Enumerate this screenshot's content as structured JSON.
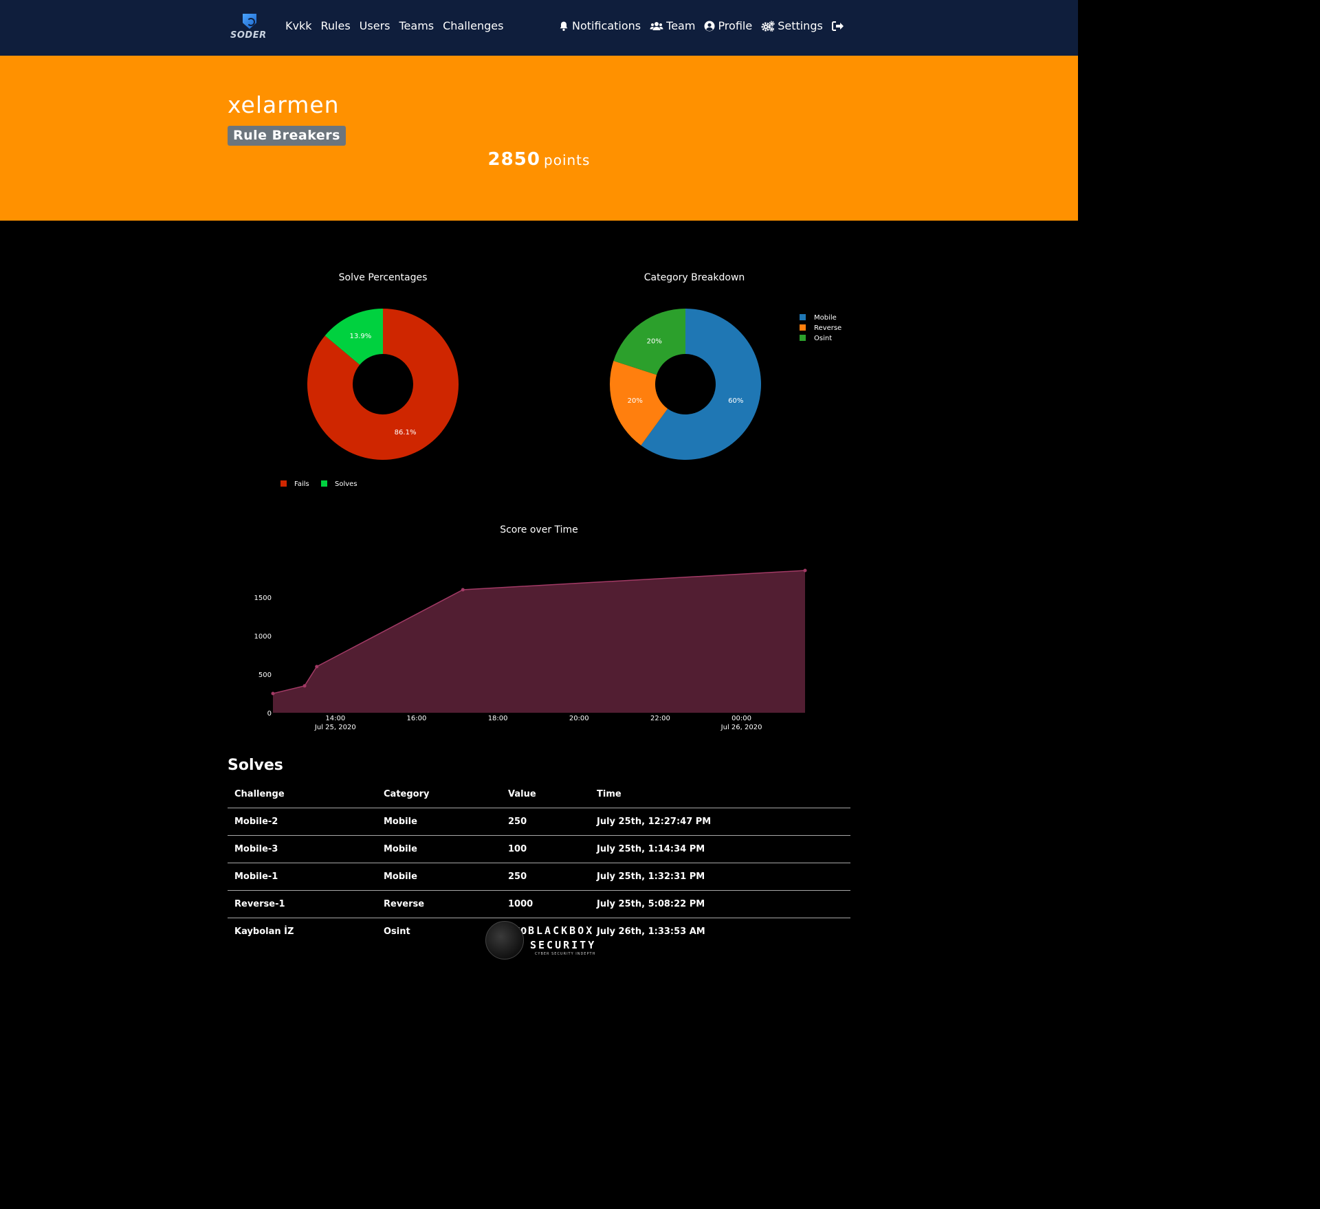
{
  "navbar": {
    "logo_text": "SODER",
    "left_links": [
      {
        "label": "Kvkk"
      },
      {
        "label": "Rules"
      },
      {
        "label": "Users"
      },
      {
        "label": "Teams"
      },
      {
        "label": "Challenges"
      }
    ],
    "right_links": [
      {
        "label": "Notifications",
        "icon": "bell-icon"
      },
      {
        "label": "Team",
        "icon": "users-icon"
      },
      {
        "label": "Profile",
        "icon": "user-circle-icon"
      },
      {
        "label": "Settings",
        "icon": "cogs-icon"
      }
    ],
    "logout_icon": "sign-out-icon",
    "colors": {
      "background": "#0f1e3c"
    }
  },
  "hero": {
    "user_name": "xelarmen",
    "team_name": "Rule Breakers",
    "points_value": "2850",
    "points_label": "points",
    "colors": {
      "background": "#ff9100",
      "badge": "#6c757d"
    }
  },
  "chart_data": [
    {
      "type": "pie",
      "title": "Solve Percentages",
      "hole": true,
      "labels": [
        "Fails",
        "Solves"
      ],
      "values": [
        86.1,
        13.9
      ],
      "value_labels": [
        "86.1%",
        "13.9%"
      ],
      "colors": [
        "#cf2600",
        "#00d13f"
      ],
      "legend": "bottom"
    },
    {
      "type": "pie",
      "title": "Category Breakdown",
      "hole": true,
      "labels": [
        "Mobile",
        "Reverse",
        "Osint"
      ],
      "values": [
        60,
        20,
        20
      ],
      "value_labels": [
        "60%",
        "20%",
        "20%"
      ],
      "colors": [
        "#1f77b4",
        "#ff7f0e",
        "#2ca02c"
      ],
      "legend": "top-right"
    },
    {
      "type": "area",
      "title": "Score over Time",
      "x": [
        "2020-07-25 12:27:47",
        "2020-07-25 13:14:34",
        "2020-07-25 13:32:31",
        "2020-07-25 17:08:22",
        "2020-07-26 01:33:53"
      ],
      "y": [
        250,
        350,
        600,
        1600,
        1850
      ],
      "ylim": [
        0,
        1850
      ],
      "xlim": [
        "2020-07-25 12:27:47",
        "2020-07-26 01:33:53"
      ],
      "y_ticks": [
        "0",
        "500",
        "1000",
        "1500"
      ],
      "x_ticks": [
        {
          "time": "14:00",
          "date": "Jul 25, 2020"
        },
        {
          "time": "16:00",
          "date": ""
        },
        {
          "time": "18:00",
          "date": ""
        },
        {
          "time": "20:00",
          "date": ""
        },
        {
          "time": "22:00",
          "date": ""
        },
        {
          "time": "00:00",
          "date": "Jul 26, 2020"
        }
      ],
      "colors": {
        "line": "#a23a65",
        "fill": "#521e32"
      }
    }
  ],
  "solves": {
    "title": "Solves",
    "columns": [
      "Challenge",
      "Category",
      "Value",
      "Time"
    ],
    "rows": [
      [
        "Mobile-2",
        "Mobile",
        "250",
        "July 25th, 12:27:47 PM"
      ],
      [
        "Mobile-3",
        "Mobile",
        "100",
        "July 25th, 1:14:34 PM"
      ],
      [
        "Mobile-1",
        "Mobile",
        "250",
        "July 25th, 1:32:31 PM"
      ],
      [
        "Reverse-1",
        "Reverse",
        "1000",
        "July 25th, 5:08:22 PM"
      ],
      [
        "Kaybolan İZ",
        "Osint",
        "250",
        "July 26th, 1:33:53 AM"
      ]
    ]
  },
  "watermark": {
    "line1": "BLACKBOX",
    "line2": "SECURITY",
    "line3": "CYBER SECURITY INDEPTH"
  }
}
